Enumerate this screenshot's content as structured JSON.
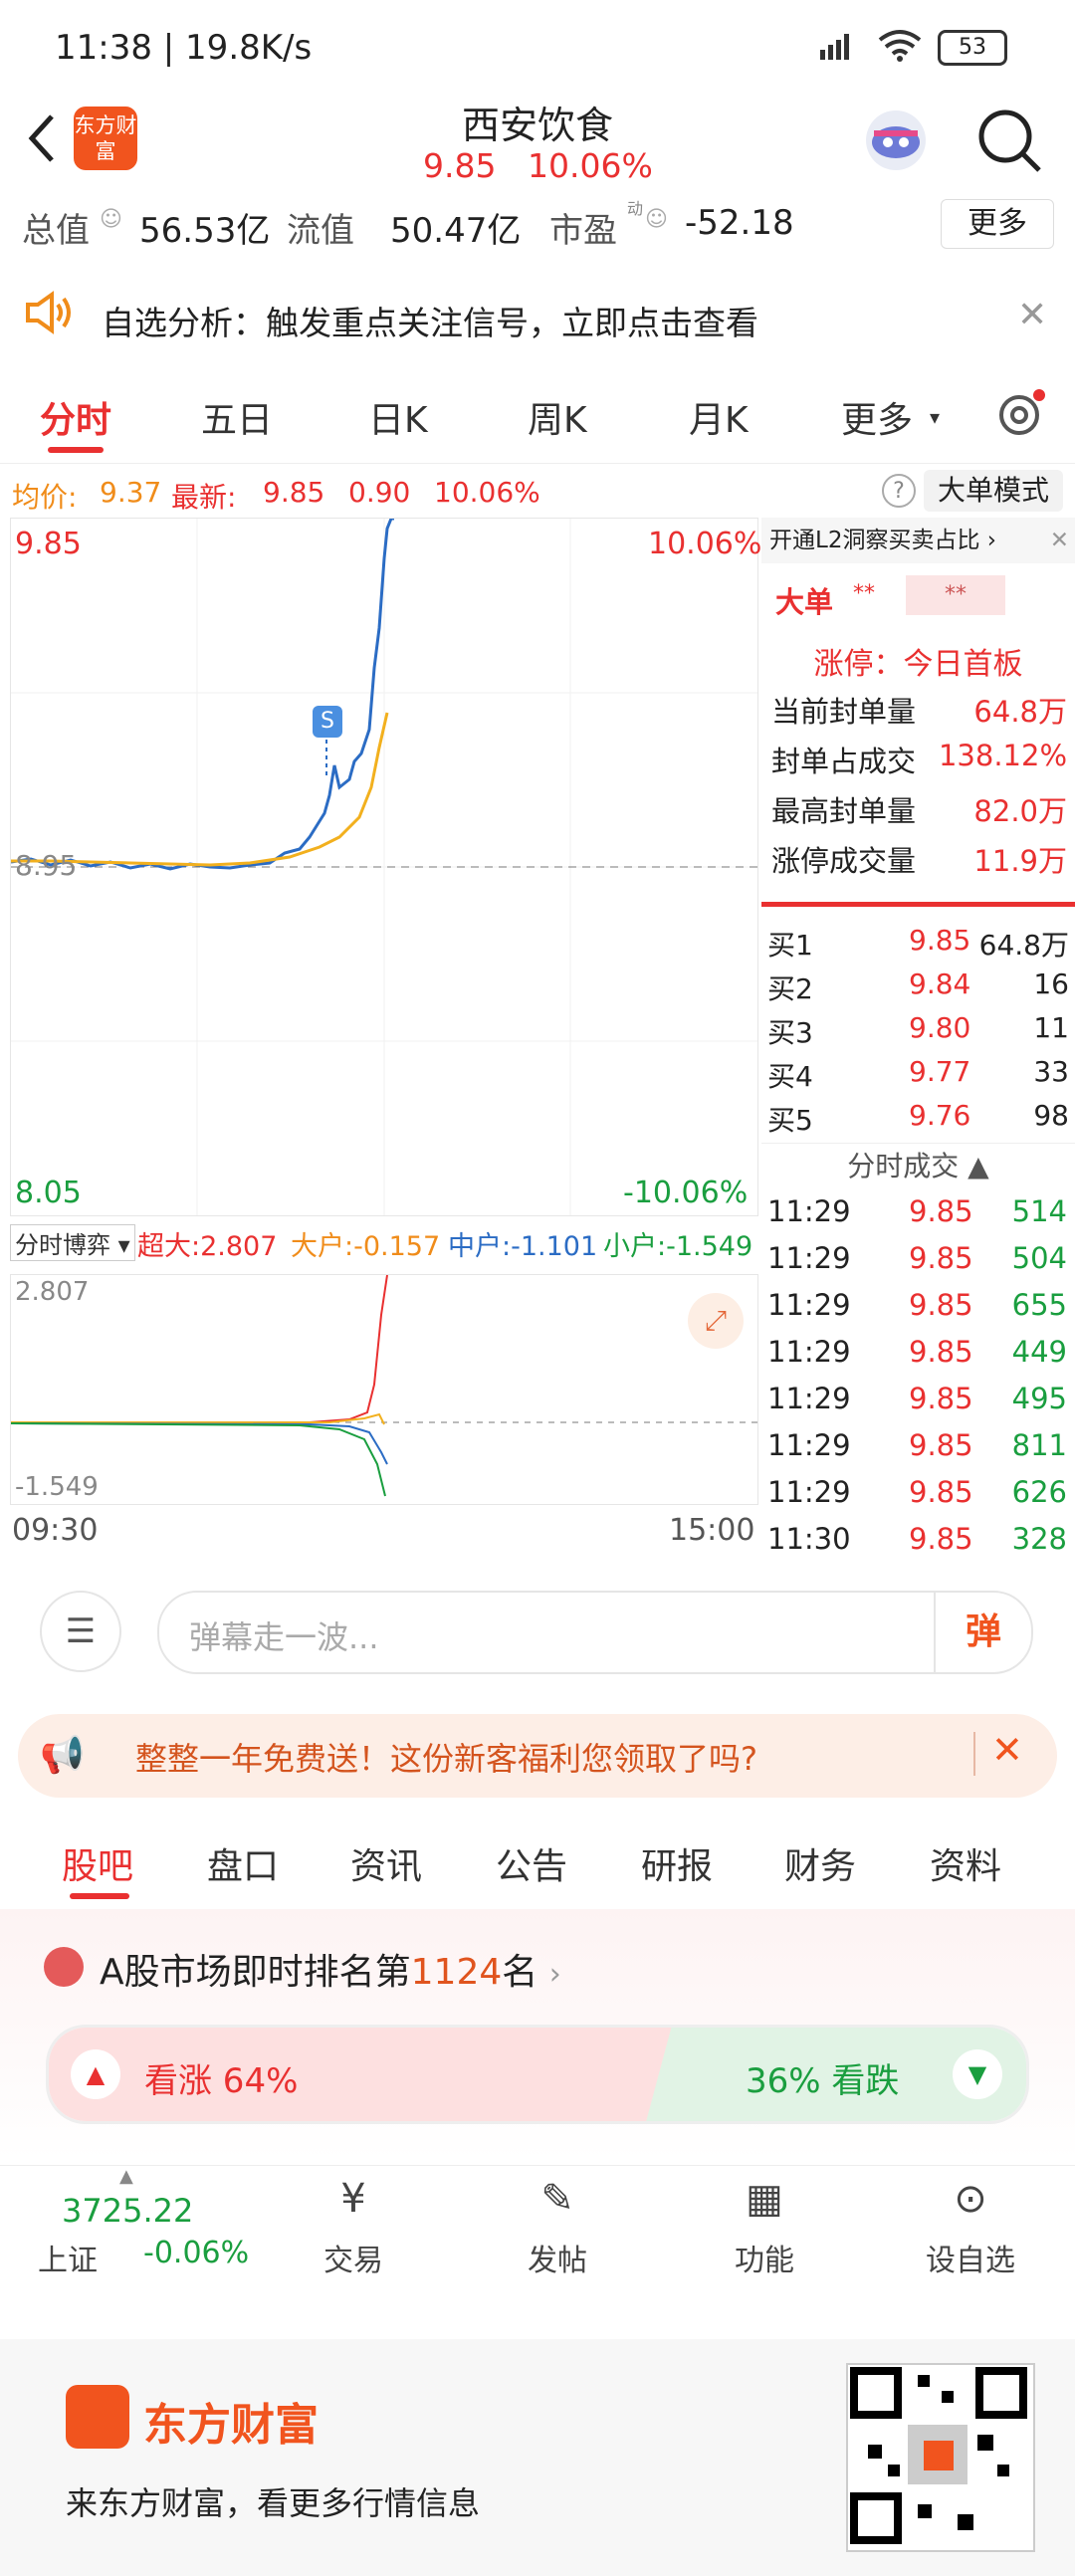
{
  "status_bar": {
    "time_speed": "11:38 | 19.8K/s",
    "battery": "53"
  },
  "header": {
    "title": "西安饮食",
    "price": "9.85",
    "change_pct": "10.06%",
    "logo_text": "东方财富"
  },
  "metrics": {
    "total_value_label": "总值",
    "total_value": "56.53亿",
    "float_label": "流值",
    "float_value": "50.47亿",
    "pe_label": "市盈",
    "pe_dyn": "动",
    "pe_value": "-52.18",
    "more_button": "更多"
  },
  "banner": {
    "text": "自选分析：触发重点关注信号，立即点击查看"
  },
  "tabs": [
    {
      "label": "分时",
      "active": true
    },
    {
      "label": "五日"
    },
    {
      "label": "日K"
    },
    {
      "label": "周K"
    },
    {
      "label": "月K"
    },
    {
      "label": "更多"
    }
  ],
  "price_line": {
    "avg_label": "均价:",
    "avg": "9.37",
    "latest_label": "最新:",
    "latest": "9.85",
    "change": "0.90",
    "change_pct": "10.06%",
    "mode_button": "大单模式"
  },
  "chart": {
    "high": "9.85",
    "high_pct": "10.06%",
    "mid": "8.95",
    "low": "8.05",
    "low_pct": "-10.06%",
    "marker": "S",
    "flow_label": "分时博弈",
    "flow_super": "超大:2.807",
    "flow_large": "大户:-0.157",
    "flow_mid": "中户:-1.101",
    "flow_small": "小户:-1.549",
    "flow_top": "2.807",
    "flow_bottom": "-1.549",
    "time_start": "09:30",
    "time_end": "15:00"
  },
  "right_panel": {
    "l2_link": "开通L2洞察买卖占比",
    "big_order": "大单",
    "big_val1": "**",
    "big_val2": "**",
    "limit_up": "涨停：今日首板",
    "stats": [
      {
        "label": "当前封单量",
        "value": "64.8万"
      },
      {
        "label": "封单占成交",
        "value": "138.12%"
      },
      {
        "label": "最高封单量",
        "value": "82.0万"
      },
      {
        "label": "涨停成交量",
        "value": "11.9万"
      }
    ],
    "bids": [
      {
        "label": "买1",
        "price": "9.85",
        "vol": "64.8万"
      },
      {
        "label": "买2",
        "price": "9.84",
        "vol": "16"
      },
      {
        "label": "买3",
        "price": "9.80",
        "vol": "11"
      },
      {
        "label": "买4",
        "price": "9.77",
        "vol": "33"
      },
      {
        "label": "买5",
        "price": "9.76",
        "vol": "98"
      }
    ],
    "trades_title": "分时成交",
    "trades": [
      {
        "time": "11:29",
        "price": "9.85",
        "vol": "514"
      },
      {
        "time": "11:29",
        "price": "9.85",
        "vol": "504"
      },
      {
        "time": "11:29",
        "price": "9.85",
        "vol": "655"
      },
      {
        "time": "11:29",
        "price": "9.85",
        "vol": "449"
      },
      {
        "time": "11:29",
        "price": "9.85",
        "vol": "495"
      },
      {
        "time": "11:29",
        "price": "9.85",
        "vol": "811"
      },
      {
        "time": "11:29",
        "price": "9.85",
        "vol": "626"
      },
      {
        "time": "11:30",
        "price": "9.85",
        "vol": "328"
      }
    ]
  },
  "comment_bar": {
    "placeholder": "弹幕走一波...",
    "danmu_button": "弹"
  },
  "promo": {
    "text": "整整一年免费送！这份新客福利您领取了吗?"
  },
  "section_tabs": [
    {
      "label": "股吧",
      "active": true
    },
    {
      "label": "盘口"
    },
    {
      "label": "资讯"
    },
    {
      "label": "公告"
    },
    {
      "label": "研报"
    },
    {
      "label": "财务"
    },
    {
      "label": "资料"
    }
  ],
  "ranking": {
    "prefix": "A股市场即时排名第",
    "rank": "1124",
    "suffix": "名"
  },
  "sentiment": {
    "up_label": "看涨 64%",
    "down_label": "36% 看跌"
  },
  "bottom_nav": {
    "index_value": "3725.22",
    "index_name": "上证",
    "index_change": "-0.06%",
    "items": [
      {
        "label": "交易"
      },
      {
        "label": "发帖"
      },
      {
        "label": "功能"
      },
      {
        "label": "设自选"
      }
    ]
  },
  "footer": {
    "brand": "东方财富",
    "slogan": "来东方财富，看更多行情信息"
  }
}
